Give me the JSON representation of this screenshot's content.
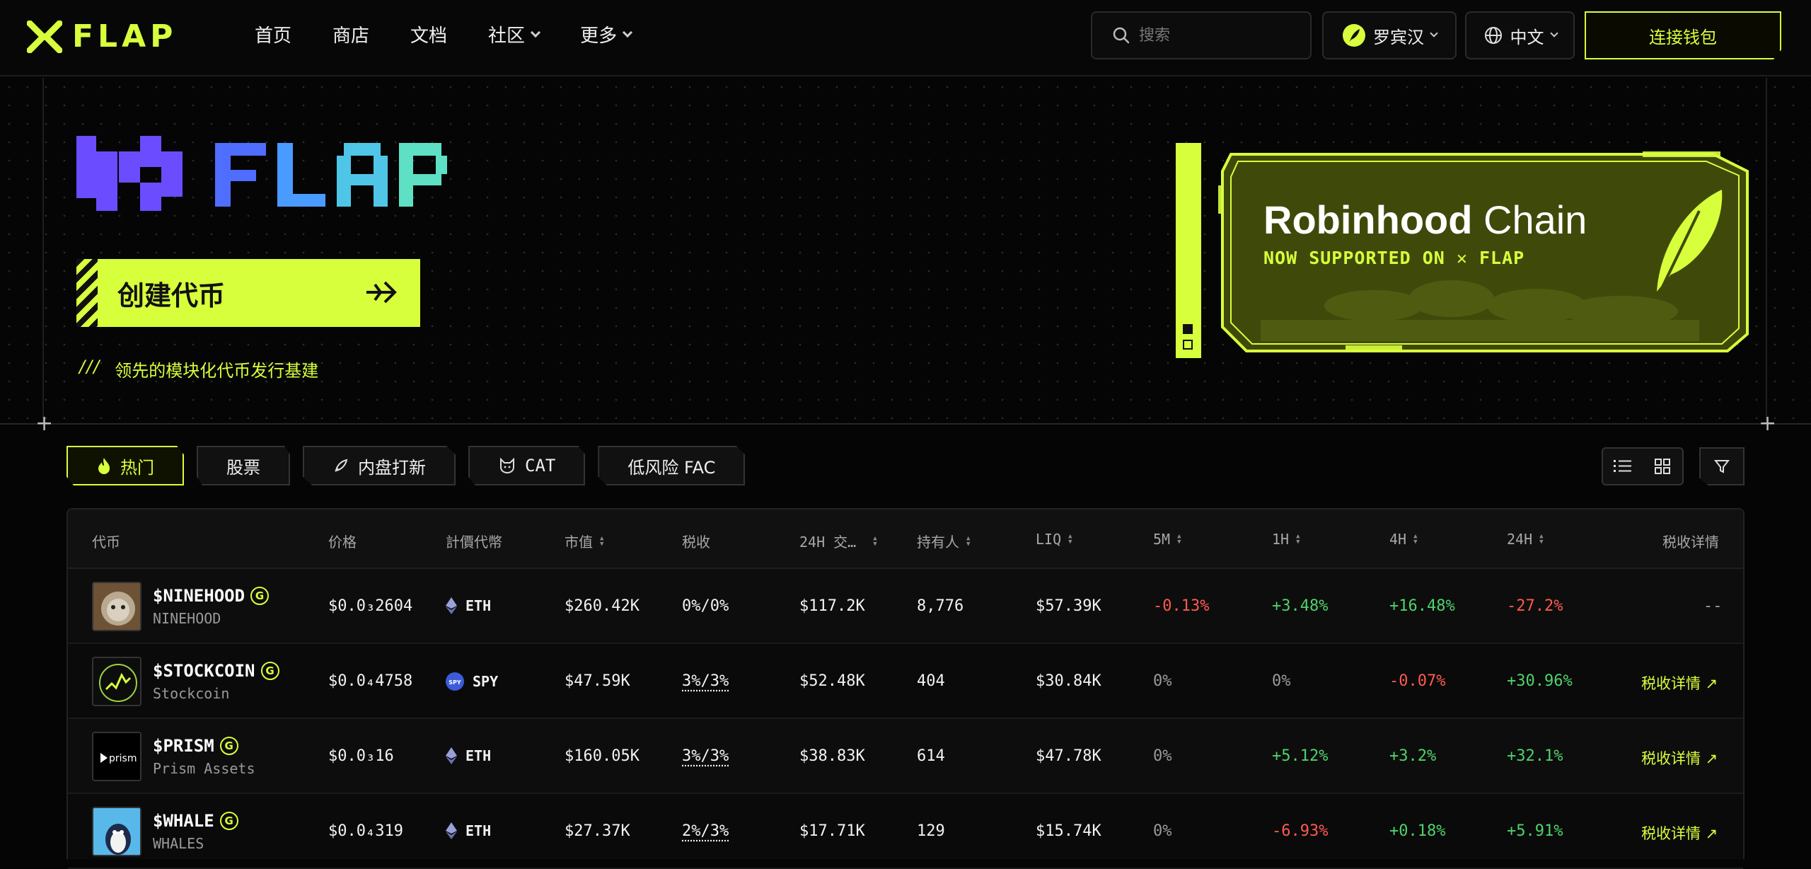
{
  "header": {
    "brand": "FLAP",
    "nav": [
      {
        "label": "首页"
      },
      {
        "label": "商店"
      },
      {
        "label": "文档"
      },
      {
        "label": "社区"
      },
      {
        "label": "更多"
      }
    ],
    "search_placeholder": "搜索",
    "chain_label": "罗宾汉",
    "language_label": "中文",
    "connect_label": "连接钱包"
  },
  "hero": {
    "create_label": "创建代币",
    "tagline_prefix": "///",
    "tagline": "领先的模块化代币发行基建",
    "banner_title_bold": "Robinhood",
    "banner_title_light": " Chain",
    "banner_subtitle": "NOW SUPPORTED ON ✕ FLAP"
  },
  "filters": [
    {
      "label": "热门",
      "icon": "flame-icon",
      "active": true
    },
    {
      "label": "股票",
      "icon": "",
      "active": false
    },
    {
      "label": "内盘打新",
      "icon": "rocket-icon",
      "active": false
    },
    {
      "label": "CAT",
      "icon": "cat-icon",
      "active": false
    },
    {
      "label": "低风险 FAC",
      "icon": "",
      "active": false
    }
  ],
  "table": {
    "columns": [
      "代币",
      "价格",
      "計價代幣",
      "市值",
      "税收",
      "24H 交…",
      "持有人",
      "LIQ",
      "5M",
      "1H",
      "4H",
      "24H",
      "税收详情"
    ],
    "rows": [
      {
        "symbol": "$NINEHOOD",
        "name": "NINEHOOD",
        "price": "$0.0₃2604",
        "quote": "ETH",
        "mcap": "$260.42K",
        "tax": "0%/0%",
        "vol": "$117.2K",
        "holders": "8,776",
        "liq": "$57.39K",
        "m5": "-0.13%",
        "h1": "+3.48%",
        "h4": "+16.48%",
        "h24": "-27.2%",
        "tax_detail": "--"
      },
      {
        "symbol": "$STOCKCOIN",
        "name": "Stockcoin",
        "price": "$0.0₄4758",
        "quote": "SPY",
        "mcap": "$47.59K",
        "tax": "3%/3%",
        "vol": "$52.48K",
        "holders": "404",
        "liq": "$30.84K",
        "m5": "0%",
        "h1": "0%",
        "h4": "-0.07%",
        "h24": "+30.96%",
        "tax_detail": "税收详情 ↗"
      },
      {
        "symbol": "$PRISM",
        "name": "Prism Assets",
        "price": "$0.0₃16",
        "quote": "ETH",
        "mcap": "$160.05K",
        "tax": "3%/3%",
        "vol": "$38.83K",
        "holders": "614",
        "liq": "$47.78K",
        "m5": "0%",
        "h1": "+5.12%",
        "h4": "+3.2%",
        "h24": "+32.1%",
        "tax_detail": "税收详情 ↗"
      },
      {
        "symbol": "$WHALE",
        "name": "WHALES",
        "price": "$0.0₄319",
        "quote": "ETH",
        "mcap": "$27.37K",
        "tax": "2%/3%",
        "vol": "$17.71K",
        "holders": "129",
        "liq": "$15.74K",
        "m5": "0%",
        "h1": "-6.93%",
        "h4": "+0.18%",
        "h24": "+5.91%",
        "tax_detail": "税收详情 ↗"
      }
    ]
  },
  "colors": {
    "accent": "#d8ff3c",
    "positive": "#4ed36a",
    "negative": "#ff5a4f",
    "background": "#050505"
  }
}
